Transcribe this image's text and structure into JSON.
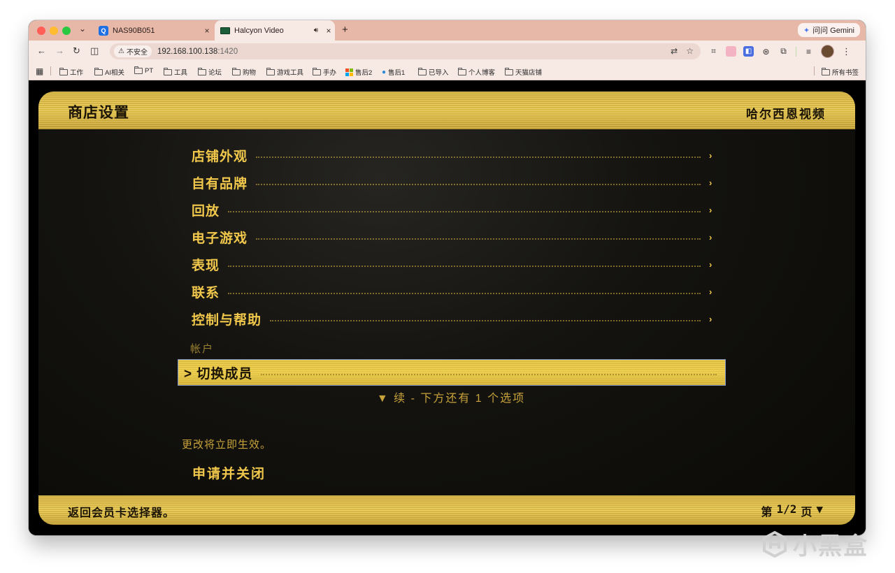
{
  "browser": {
    "tabs": [
      {
        "title": "NAS90B051",
        "icon": "q-app-icon"
      },
      {
        "title": "Halcyon Video",
        "icon": "video-tab-icon",
        "audio": true,
        "active": true
      }
    ],
    "gemini_label": "问问 Gemini",
    "insecure_label": "不安全",
    "url_host": "192.168.100.138",
    "url_port": ":1420",
    "bookmarks": [
      "工作",
      "AI相关",
      "PT",
      "工具",
      "论坛",
      "购物",
      "游戏工具",
      "手办",
      "售后2",
      "售后1",
      "已导入",
      "个人博客",
      "天猫店铺"
    ],
    "all_bookmarks_label": "所有书签"
  },
  "app": {
    "title": "商店设置",
    "brand": "哈尔西恩视频",
    "menu": [
      {
        "label": "店铺外观"
      },
      {
        "label": "自有品牌"
      },
      {
        "label": "回放"
      },
      {
        "label": "电子游戏"
      },
      {
        "label": "表现"
      },
      {
        "label": "联系"
      },
      {
        "label": "控制与帮助"
      }
    ],
    "section_label": "帐户",
    "selected_prefix": ">",
    "selected_item": "切换成员",
    "more_hint": "▼ 续 - 下方还有 1 个选项",
    "effect_note": "更改将立即生效。",
    "apply_label": "申请并关闭",
    "footer_hint": "返回会员卡选择器。",
    "page_prefix": "第",
    "page_indicator": "1/2",
    "page_suffix": "页",
    "page_arrow": "▼"
  },
  "watermark": "小黑盒"
}
